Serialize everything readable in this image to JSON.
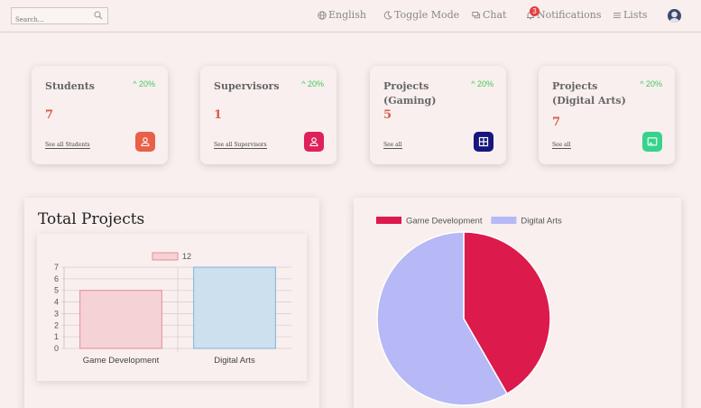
{
  "nav": {
    "search_placeholder": "Search...",
    "language": "English",
    "toggle_mode": "Toggle Mode",
    "chat": "Chat",
    "notifications": "Notifications",
    "notifications_count": "3",
    "lists": "Lists"
  },
  "cards": [
    {
      "title": "Students",
      "percent": "20%",
      "value": "7",
      "link": "See all Students",
      "icon": "person-icon",
      "icon_color": "#ea5f47"
    },
    {
      "title": "Supervisors",
      "percent": "20%",
      "value": "1",
      "link": "See all Supervisors",
      "icon": "person-icon",
      "icon_color": "#df2159"
    },
    {
      "title": "Projects (Gaming)",
      "percent": "20%",
      "value": "5",
      "link": "See all",
      "icon": "grid-icon",
      "icon_color": "#17167e"
    },
    {
      "title": "Projects (Digital Arts)",
      "percent": "20%",
      "value": "7",
      "link": "See all",
      "icon": "cast-icon",
      "icon_color": "#36d38c"
    }
  ],
  "bar_panel": {
    "title": "Total Projects"
  },
  "chart_data": [
    {
      "type": "bar",
      "categories": [
        "Game Development",
        "Digital Arts"
      ],
      "series": [
        {
          "name": "12",
          "values": [
            5,
            7
          ]
        }
      ],
      "bar_colors": [
        "#f5d2d6",
        "#cde0ee"
      ],
      "bar_borders": [
        "#e78b97",
        "#7fb3d8"
      ],
      "ylim": [
        0,
        7
      ],
      "yticks": [
        0,
        1,
        2,
        3,
        4,
        5,
        6,
        7
      ],
      "legend": "top",
      "grid": true
    },
    {
      "type": "pie",
      "labels": [
        "Game Development",
        "Digital Arts"
      ],
      "values": [
        5,
        7
      ],
      "colors": [
        "#dc1a4c",
        "#b6b9f5"
      ],
      "legend": "top-left"
    }
  ]
}
